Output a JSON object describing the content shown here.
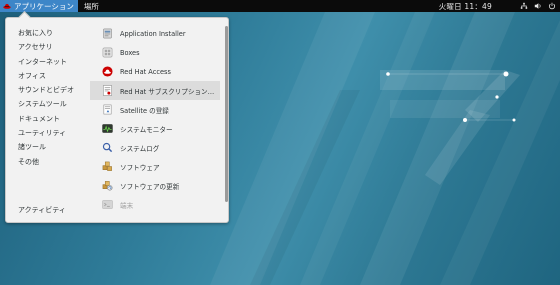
{
  "topbar": {
    "applications_label": "アプリケーション",
    "places_label": "場所",
    "clock": "火曜日 11：49",
    "tray_icons": [
      "network-icon",
      "volume-icon",
      "power-icon"
    ]
  },
  "menu": {
    "categories": [
      {
        "label": "お気に入り"
      },
      {
        "label": "アクセサリ"
      },
      {
        "label": "インターネット"
      },
      {
        "label": "オフィス"
      },
      {
        "label": "サウンドとビデオ"
      },
      {
        "label": "システムツール"
      },
      {
        "label": "ドキュメント"
      },
      {
        "label": "ユーティリティ"
      },
      {
        "label": "諸ツール"
      },
      {
        "label": "その他"
      }
    ],
    "activities_label": "アクティビティ",
    "apps": [
      {
        "label": "Application Installer",
        "icon": "package-installer-icon"
      },
      {
        "label": "Boxes",
        "icon": "boxes-icon"
      },
      {
        "label": "Red Hat Access",
        "icon": "redhat-access-icon"
      },
      {
        "label": "Red Hat サブスクリプション…",
        "icon": "subscription-icon"
      },
      {
        "label": "Satellite の登録",
        "icon": "satellite-icon"
      },
      {
        "label": "システムモニター",
        "icon": "system-monitor-icon"
      },
      {
        "label": "システムログ",
        "icon": "system-log-icon"
      },
      {
        "label": "ソフトウェア",
        "icon": "software-icon"
      },
      {
        "label": "ソフトウェアの更新",
        "icon": "software-update-icon"
      },
      {
        "label": "端末",
        "icon": "terminal-icon"
      }
    ]
  },
  "colors": {
    "topbar_bg": "#0b0b0b",
    "active_menu_bg": "#3d86c8",
    "menu_bg": "#f2f2f2",
    "hover_bg": "#dcdcdc"
  }
}
